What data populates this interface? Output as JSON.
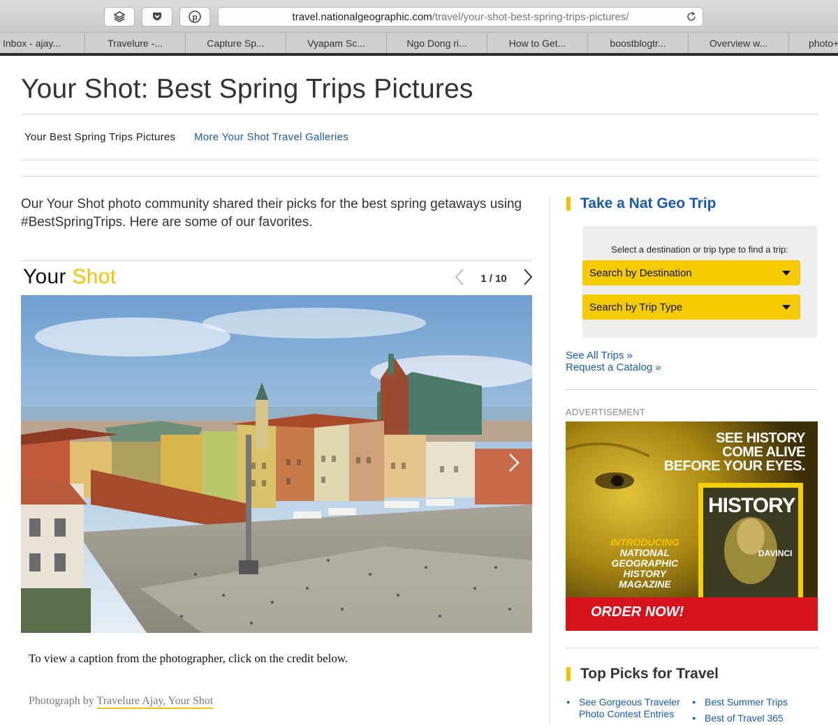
{
  "browser": {
    "url_host": "travel.nationalgeographic.com",
    "url_path": "/travel/your-shot-best-spring-trips-pictures/",
    "toolbar_icons": [
      "layers-icon",
      "pocket-icon",
      "pinterest-icon"
    ],
    "tabs": [
      "Inbox - ajay...",
      "Travelure -...",
      "Capture Sp...",
      "Vyapam Sc...",
      "Ngo Dong ri...",
      "How to Get...",
      "boostblogtr...",
      "Overview w...",
      "photo+"
    ]
  },
  "page": {
    "title": "Your Shot: Best Spring Trips Pictures",
    "subnav_current": "Your Best Spring Trips Pictures",
    "subnav_link": "More Your Shot Travel Galleries",
    "intro": "Our Your Shot photo community shared their picks for the best spring getaways using #BestSpringTrips. Here are some of our favorites."
  },
  "gallery": {
    "logo_word1": "Your",
    "logo_word2": "Shot",
    "counter": "1 / 10",
    "caption_hint": "To view a caption from the photographer, click on the credit below.",
    "credit_prefix": "Photograph by",
    "credit_link": "Travelure Ajay, Your Shot"
  },
  "sidebar": {
    "trip_heading": "Take a Nat Geo Trip",
    "trip_prompt": "Select a destination or trip type to find a trip:",
    "select_destination": "Search by Destination",
    "select_trip_type": "Search by Trip Type",
    "see_all_trips": "See All Trips »",
    "request_catalog": "Request a Catalog »",
    "ad_label": "ADVERTISEMENT",
    "top_picks_heading": "Top Picks for Travel",
    "top_picks_col1": [
      "See Gorgeous Traveler Photo Contest Entries"
    ],
    "top_picks_col2": [
      "Best Summer Trips",
      "Best of Travel 365"
    ]
  },
  "ad": {
    "headline_1": "SEE HISTORY",
    "headline_2": "COME ALIVE",
    "headline_3": "BEFORE YOUR EYES.",
    "intro_1": "INTRODUCING",
    "intro_2": "NATIONAL",
    "intro_3": "GEOGRAPHIC",
    "intro_4": "HISTORY",
    "intro_5": "MAGAZINE",
    "magazine_title": "HISTORY",
    "magazine_cover_line": "DAVINCI",
    "cta": "ORDER NOW!"
  },
  "colors": {
    "link": "#1a5aa6",
    "accent_yellow": "#f2c200",
    "ad_red": "#d6131b"
  }
}
